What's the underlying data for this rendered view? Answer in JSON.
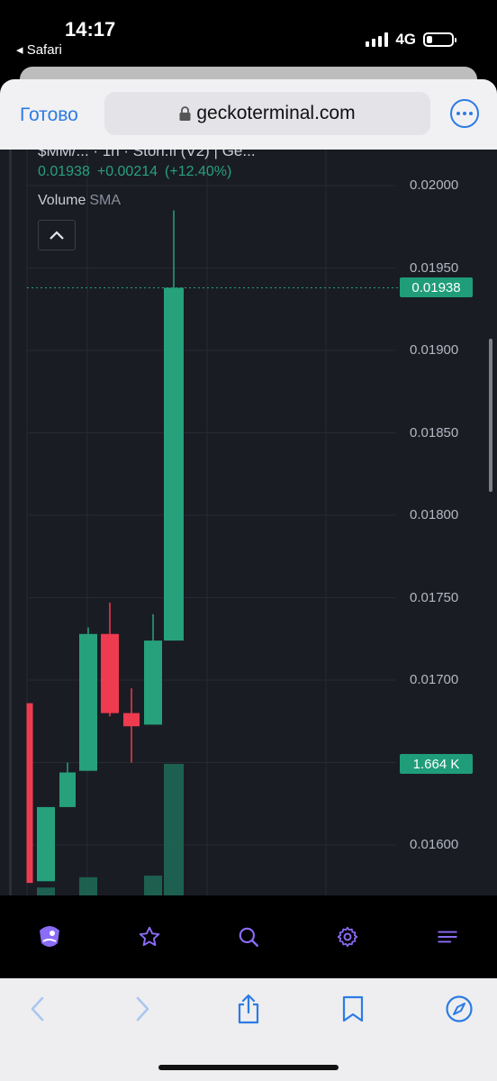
{
  "status_bar": {
    "time": "14:17",
    "back_app": "◂ Safari",
    "network": "4G"
  },
  "safari": {
    "done_label": "Готово",
    "url": "geckoterminal.com",
    "icons": [
      "lock-icon",
      "more-icon"
    ]
  },
  "chart": {
    "pair_title": "$MM/... · 1h · Ston.fi (V2) | Ge...",
    "price": "0.01938",
    "change": "+0.00214",
    "change_pct": "(+12.40%)",
    "indicator_name": "Volume",
    "indicator_sub": "SMA",
    "current_price_badge": "0.01938",
    "volume_badge": "1.664 K",
    "axis_labels": [
      "0.02000",
      "0.01950",
      "0.01900",
      "0.01850",
      "0.01800",
      "0.01750",
      "0.01700",
      "0.01600"
    ],
    "colors": {
      "up": "#26a17b",
      "down": "#ef3b4f",
      "background": "#1a1c24"
    }
  },
  "chart_data": {
    "type": "candlestick",
    "y_axis_ticks": [
      0.02,
      0.0195,
      0.019,
      0.0185,
      0.018,
      0.0175,
      0.017,
      0.016
    ],
    "candles": [
      {
        "open": 0.01686,
        "close": 0.01577,
        "high": 0.01686,
        "low": 0.01577
      },
      {
        "open": 0.01578,
        "close": 0.01623,
        "high": 0.01623,
        "low": 0.01578
      },
      {
        "open": 0.01623,
        "close": 0.01644,
        "high": 0.0165,
        "low": 0.01623
      },
      {
        "open": 0.01645,
        "close": 0.01728,
        "high": 0.01732,
        "low": 0.01645
      },
      {
        "open": 0.01728,
        "close": 0.0168,
        "high": 0.01747,
        "low": 0.01678
      },
      {
        "open": 0.0168,
        "close": 0.01672,
        "high": 0.01695,
        "low": 0.0165
      },
      {
        "open": 0.01673,
        "close": 0.01724,
        "high": 0.0174,
        "low": 0.01673
      },
      {
        "open": 0.01724,
        "close": 0.01938,
        "high": 0.01985,
        "low": 0.01724
      }
    ],
    "volumes": [
      0.0,
      0.1,
      0.0,
      0.23,
      0.0,
      0.0,
      0.25,
      1.664
    ],
    "current_price": 0.01938
  },
  "app_nav": {
    "icons": [
      "logo-icon",
      "star-icon",
      "search-icon",
      "gear-icon",
      "menu-icon"
    ]
  },
  "safari_toolbar": {
    "icons": [
      "back-icon",
      "forward-icon",
      "share-icon",
      "bookmarks-icon",
      "compass-icon"
    ]
  }
}
